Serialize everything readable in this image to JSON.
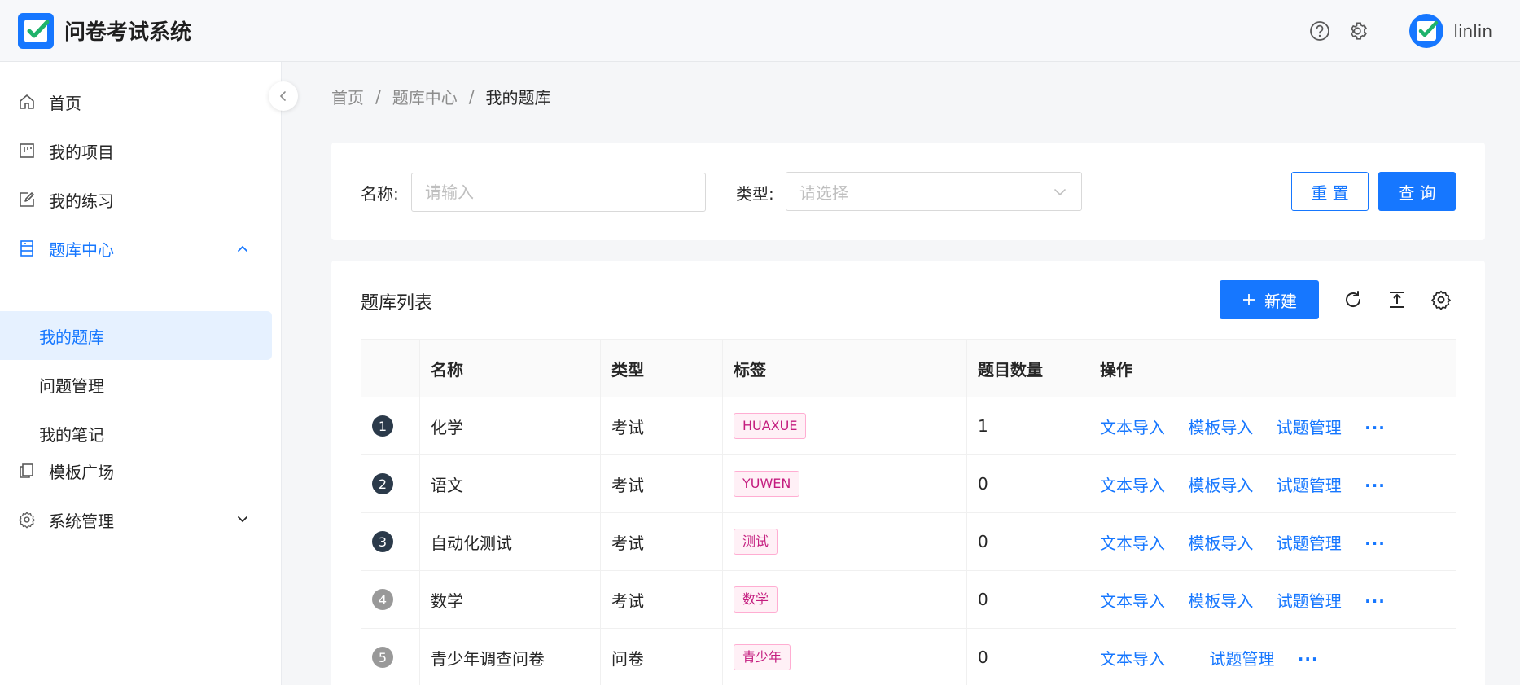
{
  "app": {
    "title": "问卷考试系统"
  },
  "header": {
    "username": "linlin"
  },
  "sidebar": {
    "items": [
      {
        "label": "首页"
      },
      {
        "label": "我的项目"
      },
      {
        "label": "我的练习"
      },
      {
        "label": "题库中心"
      },
      {
        "label": "模板广场"
      },
      {
        "label": "系统管理"
      }
    ],
    "sub_items": [
      {
        "label": "我的题库"
      },
      {
        "label": "问题管理"
      },
      {
        "label": "我的笔记"
      }
    ]
  },
  "breadcrumb": [
    "首页",
    "题库中心",
    "我的题库"
  ],
  "search": {
    "name_label": "名称:",
    "name_placeholder": "请输入",
    "type_label": "类型:",
    "type_placeholder": "请选择",
    "reset_label": "重 置",
    "query_label": "查 询"
  },
  "list": {
    "title": "题库列表",
    "new_label": "新建",
    "columns": [
      "",
      "名称",
      "类型",
      "标签",
      "题目数量",
      "操作"
    ],
    "rows": [
      {
        "index": "1",
        "name": "化学",
        "type": "考试",
        "tag": "HUAXUE",
        "count": "1",
        "actions": [
          "文本导入",
          "模板导入",
          "试题管理"
        ],
        "more": "···"
      },
      {
        "index": "2",
        "name": "语文",
        "type": "考试",
        "tag": "YUWEN",
        "count": "0",
        "actions": [
          "文本导入",
          "模板导入",
          "试题管理"
        ],
        "more": "···"
      },
      {
        "index": "3",
        "name": "自动化测试",
        "type": "考试",
        "tag": "测试",
        "count": "0",
        "actions": [
          "文本导入",
          "模板导入",
          "试题管理"
        ],
        "more": "···"
      },
      {
        "index": "4",
        "name": "数学",
        "type": "考试",
        "tag": "数学",
        "count": "0",
        "actions": [
          "文本导入",
          "模板导入",
          "试题管理"
        ],
        "more": "···"
      },
      {
        "index": "5",
        "name": "青少年调查问卷",
        "type": "问卷",
        "tag": "青少年",
        "count": "0",
        "actions": [
          "文本导入",
          "试题管理"
        ],
        "more": "···"
      }
    ]
  },
  "colors": {
    "primary": "#1677ff",
    "index_dark": "#2b3a4a",
    "index_light": "#999999",
    "tag_text": "#c41d7f"
  }
}
